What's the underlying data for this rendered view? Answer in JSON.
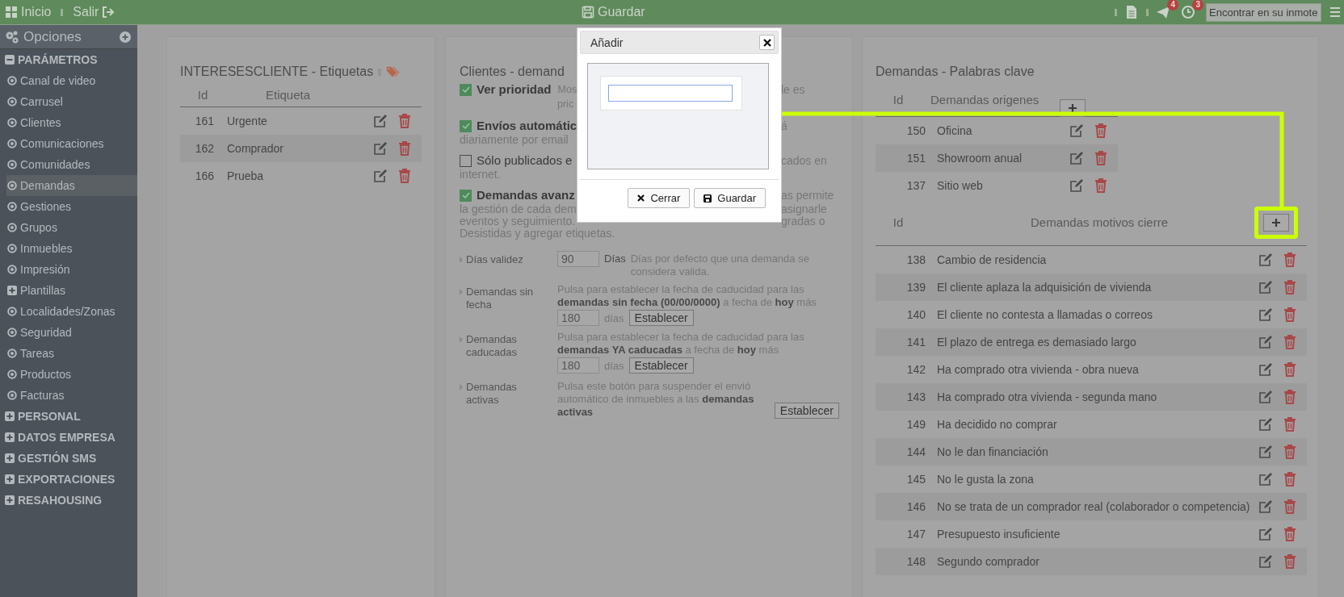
{
  "topbar": {
    "home": "Inicio",
    "logout": "Salir",
    "save": "Guardar",
    "badges": [
      {
        "kind": "messages",
        "count": "4"
      },
      {
        "kind": "alarms",
        "count": "3"
      }
    ],
    "search": {
      "placeholder": "Encontrar en su inmote"
    }
  },
  "sidebar": {
    "title": "Opciones",
    "groups": [
      {
        "label": "PARÁMETROS",
        "expanded": true,
        "items": [
          {
            "label": "Canal de video",
            "kind": "page",
            "selected": false
          },
          {
            "label": "Carrusel",
            "kind": "page",
            "selected": false
          },
          {
            "label": "Clientes",
            "kind": "page",
            "selected": false
          },
          {
            "label": "Comunicaciones",
            "kind": "page",
            "selected": false
          },
          {
            "label": "Comunidades",
            "kind": "page",
            "selected": false
          },
          {
            "label": "Demandas",
            "kind": "page",
            "selected": true
          },
          {
            "label": "Gestiones",
            "kind": "page",
            "selected": false
          },
          {
            "label": "Grupos",
            "kind": "page",
            "selected": false
          },
          {
            "label": "Inmuebles",
            "kind": "page",
            "selected": false
          },
          {
            "label": "Impresión",
            "kind": "page",
            "selected": false
          },
          {
            "label": "Plantillas",
            "kind": "folder",
            "selected": false
          },
          {
            "label": "Localidades/Zonas",
            "kind": "page",
            "selected": false
          },
          {
            "label": "Seguridad",
            "kind": "page",
            "selected": false
          },
          {
            "label": "Tareas",
            "kind": "page",
            "selected": false
          },
          {
            "label": "Productos",
            "kind": "page",
            "selected": false
          },
          {
            "label": "Facturas",
            "kind": "page",
            "selected": false
          }
        ]
      },
      {
        "label": "PERSONAL",
        "expanded": false
      },
      {
        "label": "DATOS EMPRESA",
        "expanded": false
      },
      {
        "label": "GESTIÓN SMS",
        "expanded": false
      },
      {
        "label": "EXPORTACIONES",
        "expanded": false
      },
      {
        "label": "RESAHOUSING",
        "expanded": false
      }
    ]
  },
  "left_panel": {
    "title": "INTERESESCLIENTE - Etiquetas",
    "columns": [
      "Id",
      "Etiqueta"
    ],
    "rows": [
      {
        "id": "161",
        "label": "Urgente"
      },
      {
        "id": "162",
        "label": "Comprador"
      },
      {
        "id": "166",
        "label": "Prueba"
      }
    ]
  },
  "middle_panel": {
    "title": "Clientes - demand",
    "options": [
      {
        "kind": "side",
        "checked": true,
        "strong": true,
        "label": "Ver prioridad",
        "lines": [
          {
            "start": "Mos",
            "end": "le es"
          },
          {
            "start": "pric"
          }
        ]
      },
      {
        "kind": "below",
        "checked": true,
        "strong": true,
        "label": "Envíos automátic",
        "label_end": "á",
        "lines": [
          {
            "start": "diariamente por email"
          }
        ]
      },
      {
        "kind": "below",
        "checked": false,
        "strong": false,
        "label": "Sólo publicados e",
        "label_end": "cados en",
        "lines": [
          {
            "start": "internet."
          }
        ]
      },
      {
        "kind": "below",
        "checked": true,
        "strong": true,
        "label": "Demandas avanz",
        "label_end": "as permite",
        "lines": [
          {
            "start": "la gestión de cada dem",
            "end": "asignarle"
          },
          {
            "start": "eventos y seguimiento.",
            "end": "gradas o"
          },
          {
            "start": "Desistidas y agregar etiquetas."
          }
        ]
      }
    ],
    "settings": [
      {
        "kind": "days",
        "label": "Días validez",
        "value": "90",
        "unit": "Días",
        "description": "Días por defecto que una demanda se considera valida."
      },
      {
        "kind": "reset",
        "label": "Demandas sin fecha",
        "description": "Pulsa para establecer la fecha de caducidad para las **demandas sin fecha (00/00/0000)** a fecha de **hoy** más",
        "value": "180",
        "unit": "días",
        "button": "Establecer"
      },
      {
        "kind": "reset",
        "label": "Demandas caducadas",
        "description": "Pulsa para establecer la fecha de caducidad para las **demandas YA caducadas** a fecha de **hoy** más",
        "value": "180",
        "unit": "días",
        "button": "Establecer"
      },
      {
        "kind": "action",
        "label": "Demandas activas",
        "description": "Pulsa este botón para suspender el envió automático de inmuebles a las **demandas activas**",
        "button": "Establecer"
      }
    ]
  },
  "right_panel": {
    "title": "Demandas - Palabras clave",
    "tables": [
      {
        "kind": "compact",
        "highlighted": false,
        "columns": [
          "Id",
          "Demandas origenes"
        ],
        "rows": [
          {
            "id": "150",
            "label": "Oficina"
          },
          {
            "id": "151",
            "label": "Showroom anual"
          },
          {
            "id": "137",
            "label": "Sitio web"
          }
        ]
      },
      {
        "kind": "wide",
        "highlighted": true,
        "columns": [
          "Id",
          "Demandas motivos cierre"
        ],
        "rows": [
          {
            "id": "138",
            "label": "Cambio de residencia"
          },
          {
            "id": "139",
            "label": "El cliente aplaza la adquisición de vivienda"
          },
          {
            "id": "140",
            "label": "El cliente no contesta a llamadas o correos"
          },
          {
            "id": "141",
            "label": "El plazo de entrega es demasiado largo"
          },
          {
            "id": "142",
            "label": "Ha comprado otra vivienda - obra nueva"
          },
          {
            "id": "143",
            "label": "Ha comprado otra vivienda - segunda mano"
          },
          {
            "id": "149",
            "label": "Ha decidido no comprar"
          },
          {
            "id": "144",
            "label": "No le dan financiación"
          },
          {
            "id": "145",
            "label": "No le gusta la zona"
          },
          {
            "id": "146",
            "label": "No se trata de un comprador real (colaborador o competencia)"
          },
          {
            "id": "147",
            "label": "Presupuesto insuficiente"
          },
          {
            "id": "148",
            "label": "Segundo comprador"
          }
        ]
      }
    ]
  },
  "dialog": {
    "title": "Añadir",
    "buttons": [
      {
        "kind": "close",
        "label": "Cerrar"
      },
      {
        "kind": "save",
        "label": "Guardar"
      }
    ]
  }
}
